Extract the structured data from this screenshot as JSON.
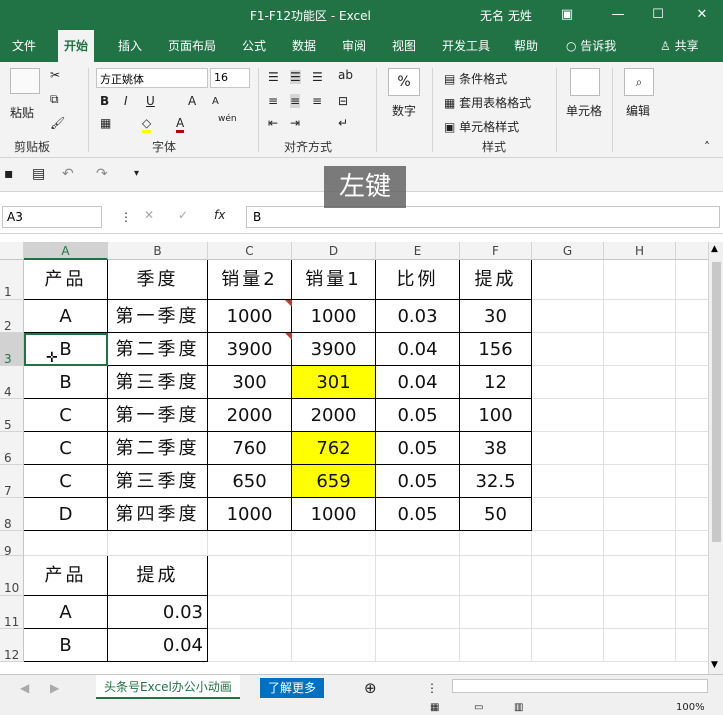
{
  "window": {
    "title": "F1-F12功能区  -  Excel",
    "user": "无名 无姓",
    "minimize": "—",
    "restore": "☐",
    "close": "✕"
  },
  "tabs": [
    "文件",
    "开始",
    "插入",
    "页面布局",
    "公式",
    "数据",
    "审阅",
    "视图",
    "开发工具",
    "帮助"
  ],
  "tell_me": "告诉我",
  "share": "共享",
  "ribbon": {
    "clipboard": {
      "label": "剪贴板",
      "paste": "粘贴"
    },
    "font": {
      "label": "字体",
      "name": "方正姚体",
      "size": "16",
      "bold": "B",
      "italic": "I",
      "underline": "U",
      "grow": "A",
      "shrink": "A"
    },
    "alignment": {
      "label": "对齐方式"
    },
    "number": {
      "label": "数字",
      "symbol": "%"
    },
    "styles": {
      "label": "样式",
      "conditional": "条件格式",
      "table": "套用表格格式",
      "cell_styles": "单元格样式"
    },
    "cells": {
      "label": "单元格"
    },
    "editing": {
      "label": "编辑"
    }
  },
  "key_hint": "左键",
  "formula_bar": {
    "name_box": "A3",
    "fx": "fx",
    "value": "B"
  },
  "columns": [
    "A",
    "B",
    "C",
    "D",
    "E",
    "F",
    "G",
    "H"
  ],
  "rows": [
    "1",
    "2",
    "3",
    "4",
    "5",
    "6",
    "7",
    "8",
    "9",
    "10",
    "11",
    "12"
  ],
  "table1": {
    "headers": [
      "产品",
      "季度",
      "销量2",
      "销量1",
      "比例",
      "提成"
    ],
    "rows": [
      [
        "A",
        "第一季度",
        "1000",
        "1000",
        "0.03",
        "30"
      ],
      [
        "B",
        "第二季度",
        "3900",
        "3900",
        "0.04",
        "156"
      ],
      [
        "B",
        "第三季度",
        "300",
        "301",
        "0.04",
        "12"
      ],
      [
        "C",
        "第一季度",
        "2000",
        "2000",
        "0.05",
        "100"
      ],
      [
        "C",
        "第二季度",
        "760",
        "762",
        "0.05",
        "38"
      ],
      [
        "C",
        "第三季度",
        "650",
        "659",
        "0.05",
        "32.5"
      ],
      [
        "D",
        "第四季度",
        "1000",
        "1000",
        "0.05",
        "50"
      ]
    ]
  },
  "table2": {
    "headers": [
      "产品",
      "提成"
    ],
    "rows": [
      [
        "A",
        "0.03"
      ],
      [
        "B",
        "0.04"
      ]
    ]
  },
  "sheets": {
    "active": "头条号Excel办公小动画",
    "other": "了解更多",
    "add": "⊕"
  },
  "status": {
    "zoom": "100%"
  },
  "colors": {
    "accent": "#217346",
    "highlight": "#ffff00"
  }
}
